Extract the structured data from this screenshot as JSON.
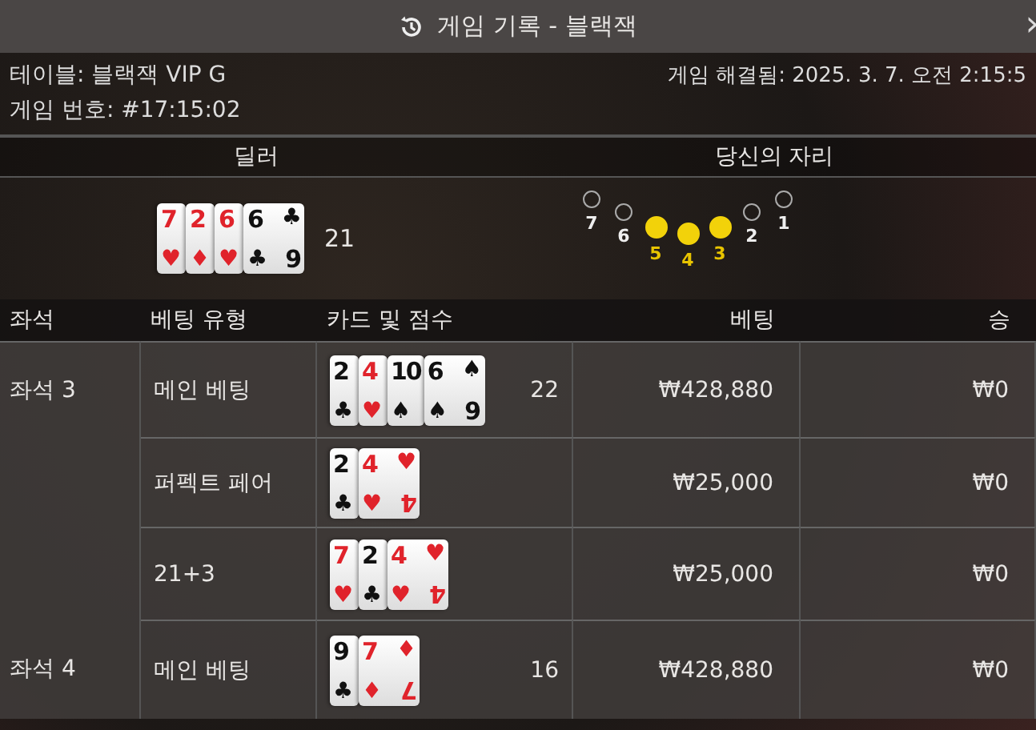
{
  "header": {
    "title": "게임 기록 - 블랙잭",
    "close": "›"
  },
  "info": {
    "table": "테이블: 블랙잭 VIP G",
    "resolved": "게임 해결됨: 2025. 3. 7. 오전 2:15:5",
    "game_no": "게임 번호: #17:15:02"
  },
  "dealer": {
    "heading": "딜러",
    "score": "21",
    "cards": [
      {
        "rank": "7",
        "suit": "♥"
      },
      {
        "rank": "2",
        "suit": "♦"
      },
      {
        "rank": "6",
        "suit": "♥"
      },
      {
        "rank": "6",
        "suit": "♣",
        "rank_corner": "6"
      }
    ]
  },
  "seats": {
    "heading": "당신의 자리",
    "items": [
      {
        "label": "7",
        "selected": false
      },
      {
        "label": "6",
        "selected": false
      },
      {
        "label": "5",
        "selected": true
      },
      {
        "label": "4",
        "selected": true
      },
      {
        "label": "3",
        "selected": true
      },
      {
        "label": "2",
        "selected": false
      },
      {
        "label": "1",
        "selected": false
      }
    ]
  },
  "table": {
    "columns": [
      "좌석",
      "베팅 유형",
      "카드 및 점수",
      "베팅",
      "승"
    ],
    "rows": [
      {
        "seat": "좌석 3",
        "bet_type": "메인 베팅",
        "score": "22",
        "bet": "₩428,880",
        "win": "₩0",
        "cards": [
          {
            "rank": "2",
            "suit": "♣"
          },
          {
            "rank": "4",
            "suit": "♥"
          },
          {
            "rank": "10",
            "suit": "♠"
          },
          {
            "rank": "6",
            "suit": "♠",
            "rank_corner": "6"
          }
        ]
      },
      {
        "bet_type": "퍼펙트 페어",
        "bet": "₩25,000",
        "win": "₩0",
        "cards": [
          {
            "rank": "2",
            "suit": "♣"
          },
          {
            "rank": "4",
            "suit": "♥",
            "rank_corner": "4"
          }
        ]
      },
      {
        "bet_type": "21+3",
        "bet": "₩25,000",
        "win": "₩0",
        "cards": [
          {
            "rank": "7",
            "suit": "♥"
          },
          {
            "rank": "2",
            "suit": "♣"
          },
          {
            "rank": "4",
            "suit": "♥",
            "rank_corner": "4"
          }
        ]
      },
      {
        "seat": "좌석 4",
        "bet_type": "메인 베팅",
        "score": "16",
        "bet": "₩428,880",
        "win": "₩0",
        "cards": [
          {
            "rank": "9",
            "suit": "♣"
          },
          {
            "rank": "7",
            "suit": "♦",
            "rank_corner": "7"
          }
        ]
      }
    ]
  }
}
